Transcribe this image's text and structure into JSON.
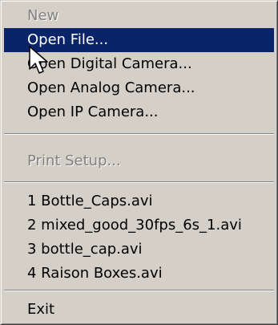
{
  "menu": {
    "items": [
      {
        "label": "New",
        "disabled": true
      },
      {
        "label": "Open File...",
        "highlighted": true
      },
      {
        "label": "Open Digital Camera..."
      },
      {
        "label": "Open Analog Camera..."
      },
      {
        "label": "Open IP Camera..."
      },
      {
        "label": "Print Setup...",
        "disabled": true
      },
      {
        "label": "1 Bottle_Caps.avi"
      },
      {
        "label": "2 mixed_good_30fps_6s_1.avi"
      },
      {
        "label": "3 bottle_cap.avi"
      },
      {
        "label": "4 Raison Boxes.avi"
      },
      {
        "label": "Exit"
      }
    ]
  },
  "colors": {
    "menu_background": "#d4d0c8",
    "highlight_background": "#0a246a",
    "highlight_text": "#ffffff",
    "disabled_text": "#808080"
  },
  "icons": {
    "pointer": "mouse-pointer-icon"
  }
}
